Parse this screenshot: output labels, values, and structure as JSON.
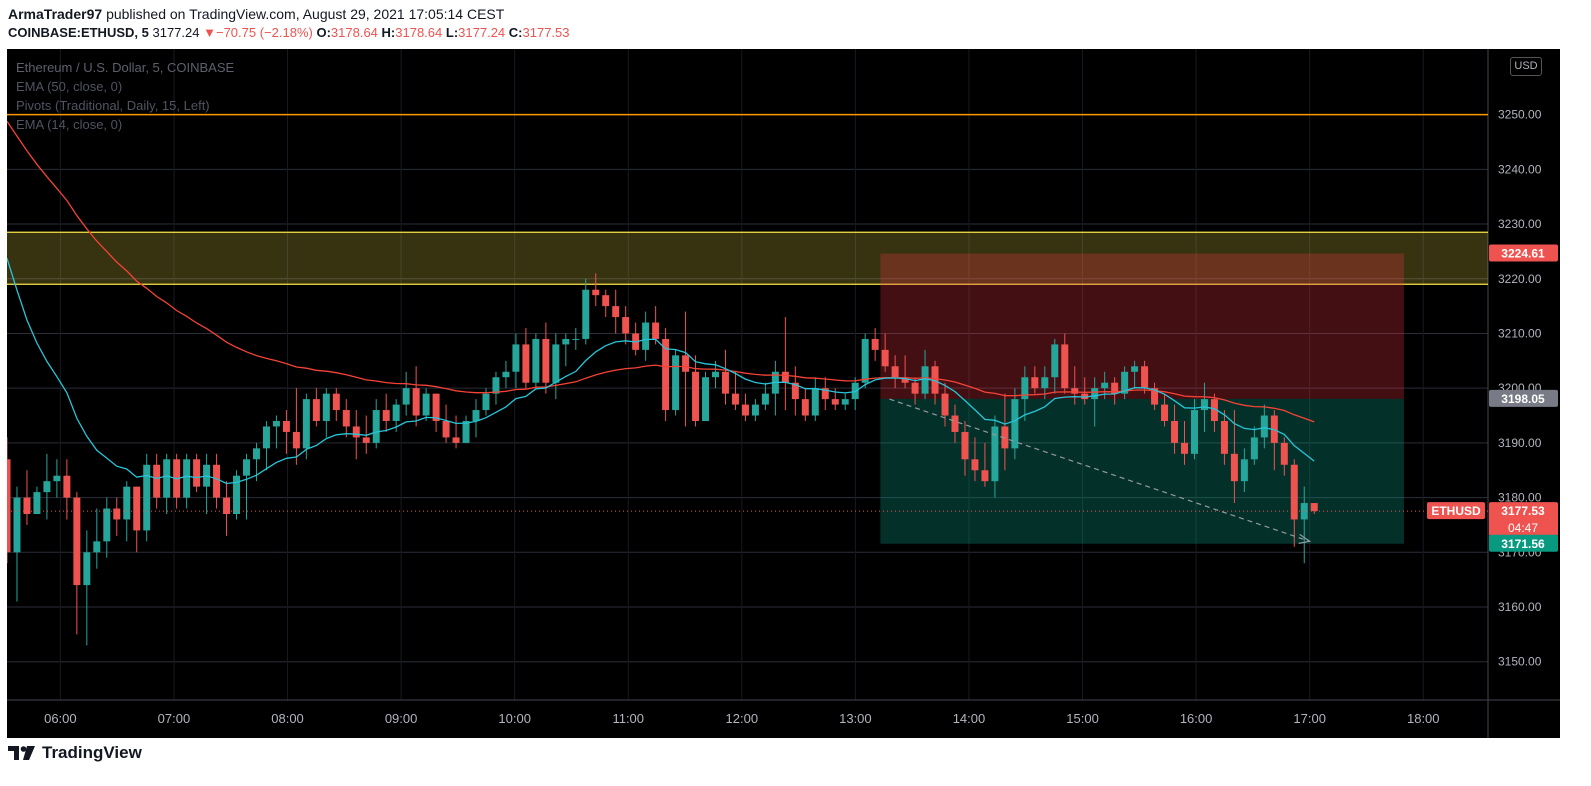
{
  "header": {
    "author": "ArmaTrader97",
    "published_text": "published on TradingView.com, August 29, 2021 17:05:14 CEST",
    "symbol": "COINBASE:ETHUSD, 5",
    "last": "3177.24",
    "change_arrow": "▼",
    "change": "−70.75 (−2.18%)",
    "o_label": "O:",
    "o_value": "3178.64",
    "h_label": "H:",
    "h_value": "3178.64",
    "l_label": "L:",
    "l_value": "3177.24",
    "c_label": "C:",
    "c_value": "3177.53"
  },
  "legend": {
    "title": "Ethereum / U.S. Dollar, 5, COINBASE",
    "ind1": "EMA (50, close, 0)",
    "ind2": "Pivots (Traditional, Daily, 15, Left)",
    "ind3": "EMA (14, close, 0)"
  },
  "currency_badge": "USD",
  "footer": {
    "brand": "TradingView"
  },
  "colors": {
    "up": "#26a69a",
    "down": "#ef5350",
    "ema50": "#f44336",
    "ema14": "#26c6da",
    "pivot": "#ff9800",
    "zone": "#f9e547",
    "target": "#089981",
    "stop": "#f23645"
  },
  "chart_data": {
    "type": "candlestick",
    "title": "Ethereum / U.S. Dollar, 5, COINBASE",
    "xlabel": "",
    "ylabel": "",
    "ylim": [
      3143,
      3262
    ],
    "xlim_hours": [
      5.53,
      18.57
    ],
    "y_ticks": [
      "3150.00",
      "3160.00",
      "3170.00",
      "3180.00",
      "3190.00",
      "3200.00",
      "3210.00",
      "3220.00",
      "3230.00",
      "3240.00",
      "3250.00"
    ],
    "x_ticks": [
      "06:00",
      "07:00",
      "08:00",
      "09:00",
      "10:00",
      "11:00",
      "12:00",
      "13:00",
      "14:00",
      "15:00",
      "16:00",
      "17:00",
      "18:00"
    ],
    "grid": true,
    "price_labels": [
      {
        "text": "3224.61",
        "value": 3224.61,
        "color": "#ef5350"
      },
      {
        "text": "3198.05",
        "value": 3198.05,
        "color": "#787b86"
      },
      {
        "text": "3177.53",
        "value": 3177.53,
        "color": "#ef5350",
        "sub": "04:47",
        "tag": "ETHUSD"
      },
      {
        "text": "3171.56",
        "value": 3171.56,
        "color": "#089981"
      }
    ],
    "pivot_line": 3250.0,
    "zone": [
      3219.0,
      3228.5
    ],
    "position": {
      "start_hour": 13.22,
      "end_hour": 17.83,
      "entry": 3198.05,
      "stop": 3224.61,
      "target": 3171.56
    },
    "last_price": 3177.53,
    "trend_arrow": {
      "from_hour": 13.3,
      "from": 3198.0,
      "to_hour": 17.0,
      "to": 3172.0
    },
    "candles": [
      [
        3187,
        3191,
        3168,
        3170
      ],
      [
        3170,
        3182,
        3161,
        3180
      ],
      [
        3180,
        3185,
        3175,
        3177
      ],
      [
        3177,
        3182,
        3178,
        3181
      ],
      [
        3181,
        3188,
        3176,
        3183
      ],
      [
        3183,
        3187,
        3180,
        3184
      ],
      [
        3184,
        3187,
        3176,
        3180
      ],
      [
        3180,
        3181,
        3155,
        3164
      ],
      [
        3164,
        3174,
        3153,
        3170
      ],
      [
        3170,
        3178,
        3167,
        3172
      ],
      [
        3172,
        3180,
        3169,
        3178
      ],
      [
        3178,
        3180,
        3173,
        3176
      ],
      [
        3176,
        3183,
        3172,
        3182
      ],
      [
        3182,
        3182,
        3170,
        3174
      ],
      [
        3174,
        3188,
        3172,
        3186
      ],
      [
        3186,
        3188,
        3178,
        3180
      ],
      [
        3180,
        3188,
        3177,
        3187
      ],
      [
        3187,
        3188,
        3178,
        3180
      ],
      [
        3180,
        3188,
        3178,
        3187
      ],
      [
        3187,
        3188,
        3181,
        3182
      ],
      [
        3182,
        3188,
        3177,
        3186
      ],
      [
        3186,
        3188,
        3178,
        3180
      ],
      [
        3180,
        3183,
        3173,
        3177
      ],
      [
        3177,
        3185,
        3176,
        3184
      ],
      [
        3184,
        3188,
        3176,
        3187
      ],
      [
        3187,
        3190,
        3183,
        3189
      ],
      [
        3189,
        3194,
        3185,
        3193
      ],
      [
        3193,
        3195,
        3189,
        3194
      ],
      [
        3194,
        3196,
        3188,
        3192
      ],
      [
        3192,
        3200,
        3186,
        3189
      ],
      [
        3189,
        3199,
        3187,
        3198
      ],
      [
        3198,
        3200,
        3193,
        3194
      ],
      [
        3194,
        3200,
        3191,
        3199
      ],
      [
        3199,
        3200,
        3194,
        3196
      ],
      [
        3196,
        3198,
        3191,
        3193
      ],
      [
        3193,
        3196,
        3187,
        3191
      ],
      [
        3191,
        3195,
        3188,
        3190
      ],
      [
        3190,
        3198,
        3189,
        3196
      ],
      [
        3196,
        3199,
        3192,
        3194
      ],
      [
        3194,
        3198,
        3192,
        3197
      ],
      [
        3197,
        3203,
        3195,
        3200
      ],
      [
        3200,
        3204,
        3193,
        3195
      ],
      [
        3195,
        3200,
        3194,
        3199
      ],
      [
        3199,
        3199,
        3192,
        3194
      ],
      [
        3194,
        3197,
        3190,
        3191
      ],
      [
        3191,
        3195,
        3189,
        3190
      ],
      [
        3190,
        3195,
        3190,
        3194
      ],
      [
        3194,
        3198,
        3191,
        3196
      ],
      [
        3196,
        3200,
        3195,
        3199
      ],
      [
        3199,
        3203,
        3197,
        3202
      ],
      [
        3202,
        3205,
        3200,
        3203
      ],
      [
        3203,
        3210,
        3200,
        3208
      ],
      [
        3208,
        3211,
        3200,
        3201
      ],
      [
        3201,
        3210,
        3200,
        3209
      ],
      [
        3209,
        3212,
        3199,
        3201
      ],
      [
        3201,
        3210,
        3198,
        3208
      ],
      [
        3208,
        3210,
        3204,
        3209
      ],
      [
        3209,
        3211,
        3207,
        3209
      ],
      [
        3209,
        3220,
        3208,
        3218
      ],
      [
        3218,
        3221,
        3215,
        3217
      ],
      [
        3217,
        3218,
        3213,
        3215
      ],
      [
        3215,
        3218,
        3210,
        3213
      ],
      [
        3213,
        3215,
        3208,
        3210
      ],
      [
        3210,
        3212,
        3206,
        3207
      ],
      [
        3207,
        3214,
        3205,
        3212
      ],
      [
        3212,
        3215,
        3208,
        3209
      ],
      [
        3209,
        3211,
        3194,
        3196
      ],
      [
        3196,
        3207,
        3195,
        3206
      ],
      [
        3206,
        3214,
        3193,
        3203
      ],
      [
        3203,
        3206,
        3193,
        3194
      ],
      [
        3194,
        3203,
        3194,
        3202
      ],
      [
        3202,
        3205,
        3200,
        3203
      ],
      [
        3203,
        3207,
        3197,
        3199
      ],
      [
        3199,
        3203,
        3196,
        3197
      ],
      [
        3197,
        3199,
        3194,
        3195
      ],
      [
        3195,
        3198,
        3194,
        3197
      ],
      [
        3197,
        3201,
        3196,
        3199
      ],
      [
        3199,
        3205,
        3195,
        3203
      ],
      [
        3203,
        3213,
        3196,
        3201
      ],
      [
        3201,
        3204,
        3195,
        3198
      ],
      [
        3198,
        3200,
        3194,
        3195
      ],
      [
        3195,
        3202,
        3194,
        3200
      ],
      [
        3200,
        3202,
        3196,
        3198
      ],
      [
        3198,
        3200,
        3196,
        3197
      ],
      [
        3197,
        3199,
        3196,
        3198
      ],
      [
        3198,
        3202,
        3196,
        3201
      ],
      [
        3201,
        3210,
        3200,
        3209
      ],
      [
        3209,
        3211,
        3205,
        3207
      ],
      [
        3207,
        3210,
        3203,
        3204
      ],
      [
        3204,
        3206,
        3200,
        3202
      ],
      [
        3202,
        3206,
        3200,
        3201
      ],
      [
        3201,
        3202,
        3197,
        3199
      ],
      [
        3199,
        3207,
        3198,
        3204
      ],
      [
        3204,
        3205,
        3197,
        3199
      ],
      [
        3199,
        3201,
        3193,
        3195
      ],
      [
        3195,
        3197,
        3190,
        3192
      ],
      [
        3192,
        3194,
        3184,
        3187
      ],
      [
        3187,
        3191,
        3183,
        3185
      ],
      [
        3185,
        3190,
        3182,
        3183
      ],
      [
        3183,
        3195,
        3180,
        3193
      ],
      [
        3193,
        3199,
        3185,
        3189
      ],
      [
        3189,
        3200,
        3187,
        3198
      ],
      [
        3198,
        3204,
        3194,
        3202
      ],
      [
        3202,
        3204,
        3199,
        3200
      ],
      [
        3200,
        3204,
        3198,
        3202
      ],
      [
        3202,
        3209,
        3199,
        3208
      ],
      [
        3208,
        3210,
        3199,
        3200
      ],
      [
        3200,
        3204,
        3197,
        3199
      ],
      [
        3199,
        3202,
        3197,
        3198
      ],
      [
        3198,
        3202,
        3193,
        3200
      ],
      [
        3200,
        3203,
        3198,
        3201
      ],
      [
        3201,
        3202,
        3197,
        3199
      ],
      [
        3199,
        3204,
        3198,
        3203
      ],
      [
        3203,
        3205,
        3200,
        3204
      ],
      [
        3204,
        3205,
        3199,
        3200
      ],
      [
        3200,
        3201,
        3196,
        3197
      ],
      [
        3197,
        3199,
        3193,
        3194
      ],
      [
        3194,
        3197,
        3188,
        3190
      ],
      [
        3190,
        3194,
        3186,
        3188
      ],
      [
        3188,
        3198,
        3187,
        3196
      ],
      [
        3196,
        3201,
        3192,
        3198
      ],
      [
        3198,
        3199,
        3192,
        3194
      ],
      [
        3194,
        3196,
        3186,
        3188
      ],
      [
        3188,
        3196,
        3179,
        3183
      ],
      [
        3183,
        3189,
        3181,
        3187
      ],
      [
        3187,
        3193,
        3186,
        3191
      ],
      [
        3191,
        3197,
        3189,
        3195
      ],
      [
        3195,
        3196,
        3185,
        3190
      ],
      [
        3190,
        3191,
        3184,
        3186
      ],
      [
        3186,
        3187,
        3171,
        3176
      ],
      [
        3176,
        3182,
        3168,
        3179
      ],
      [
        3179,
        3179,
        3177,
        3177.53
      ]
    ]
  }
}
